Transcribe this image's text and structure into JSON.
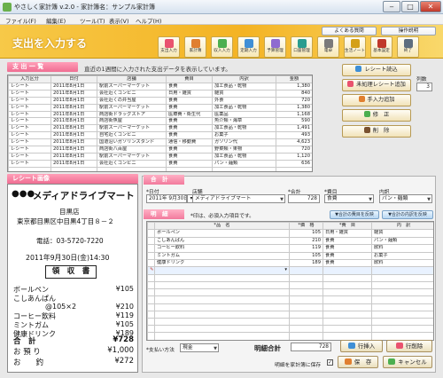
{
  "window": {
    "title": "やさしく家計簿 v.2.0 - 家計簿名：サンプル家計簿"
  },
  "menu": [
    "ファイル(F)",
    "編集(E)",
    "ツール(T)",
    "表示(V)",
    "ヘルプ(H)"
  ],
  "banner": {
    "title": "支出を入力する",
    "faq": "よくある質問",
    "manual": "操作説明",
    "toolbar": [
      {
        "label": "支出入力",
        "icon": "expense-input-icon",
        "color": "#e9536f"
      },
      {
        "label": "家計簿",
        "icon": "ledger-icon",
        "color": "#e07f30"
      },
      {
        "label": "収入入力",
        "icon": "income-input-icon",
        "color": "#4caf50"
      },
      {
        "label": "定期入力",
        "icon": "recurring-icon",
        "color": "#3f8fd6"
      },
      {
        "label": "予算管理",
        "icon": "budget-icon",
        "color": "#8e6bd0"
      },
      {
        "label": "口座管理",
        "icon": "account-icon",
        "color": "#2a9d8f"
      },
      {
        "label": "電卓",
        "icon": "calculator-icon",
        "color": "#7a7a7a"
      },
      {
        "label": "生活ノート",
        "icon": "note-icon",
        "color": "#d4a017"
      },
      {
        "label": "基本設定",
        "icon": "settings-icon",
        "color": "#c0392b"
      },
      {
        "label": "終了",
        "icon": "exit-icon",
        "color": "#5d6d7e"
      }
    ]
  },
  "list": {
    "heading": "支 出 一 覧",
    "notice": "直近の1週間に入力された支出データを表示しています。",
    "columns": [
      "入力区分",
      "日付",
      "店舗",
      "費目",
      "内訳",
      "金額"
    ],
    "rows": [
      [
        "レシート",
        "2011年8月1日",
        "駅前スーパーマーケット",
        "食費",
        "加工食品・乾物",
        "1,380"
      ],
      [
        "レシート",
        "2011年8月1日",
        "会社近くコンビニ",
        "日用・雑貨",
        "雑貨",
        "840"
      ],
      [
        "レシート",
        "2011年8月1日",
        "会社近くの弁当屋",
        "食費",
        "外食",
        "720"
      ],
      [
        "レシート",
        "2011年8月1日",
        "駅前スーパーマーケット",
        "食費",
        "加工食品・乾物",
        "1,380"
      ],
      [
        "レシート",
        "2011年8月1日",
        "商店街ドラッグストア",
        "医療費・衛生代",
        "医薬品",
        "1,168"
      ],
      [
        "レシート",
        "2011年8月1日",
        "商店街魚屋",
        "食費",
        "魚介類・海草",
        "590"
      ],
      [
        "レシート",
        "2011年8月1日",
        "駅前スーパーマーケット",
        "食費",
        "加工食品・乾物",
        "1,491"
      ],
      [
        "レシート",
        "2011年8月1日",
        "自宅近くコンビニ",
        "食費",
        "お菓子",
        "493"
      ],
      [
        "レシート",
        "2011年8月1日",
        "国道沿いガソリンスタンド",
        "通信・移動費",
        "ガソリン代",
        "4,623"
      ],
      [
        "レシート",
        "2011年8月1日",
        "商店街八百屋",
        "食費",
        "野菜類・果物",
        "720"
      ],
      [
        "レシート",
        "2011年8月1日",
        "駅前スーパーマーケット",
        "食費",
        "加工食品・乾物",
        "1,120"
      ],
      [
        "レシート",
        "2011年8月1日",
        "会社近くコンビニ",
        "食費",
        "パン・麺類",
        "636"
      ]
    ]
  },
  "side": {
    "read_receipt": "レシート読込",
    "unprocessed": "未処理レシート追加",
    "manual_add": "手入力追加",
    "edit": "修　正",
    "delete": "削　除",
    "count_label": "列数",
    "count_value": "3"
  },
  "receipt": {
    "heading": "レシート画像",
    "store": "メディアドライブマート",
    "branch": "目黒店",
    "address": "東京都目黒区中目黒4丁目８－２",
    "phone": "電話：03-5720-7220",
    "datetime": "2011年9月30日(金)14:30",
    "doc_title": "領　収　書",
    "lines": [
      {
        "name": "ボールペン",
        "price": "¥105"
      },
      {
        "name": "こしあんぱん",
        "price": ""
      },
      {
        "name": "@105×2",
        "price": "¥210"
      },
      {
        "name": "コーヒー飲料",
        "price": "¥119"
      },
      {
        "name": "ミントガム",
        "price": "¥105"
      },
      {
        "name": "健康ドリンク",
        "price": "¥189"
      }
    ],
    "total_label": "合　計",
    "total": "¥728",
    "paid_label": "お 預 り",
    "paid": "¥1,000",
    "change_label": "お　　釣",
    "change": "¥272"
  },
  "entry": {
    "heading": "合　計",
    "date_label": "*日付",
    "date_value": "2011年  9月30日",
    "store_label": "店舗",
    "store_value": "メディアドライブマート",
    "amount_label": "*合計",
    "amount_value": "728",
    "category_label": "*費目",
    "category_value": "食費",
    "subcategory_label": "内訳",
    "subcategory_value": "パン・麺類",
    "detail_heading": "明　細",
    "detail_note": "*印は、必須入力項目です。",
    "apply_all": "▼合計の費目を反映",
    "apply_sub": "▼合計の内訳を反映",
    "grid_columns": [
      "*品　名",
      "*価　格",
      "*費　目",
      "内　訳"
    ],
    "grid_rows": [
      [
        "ボールペン",
        "105",
        "日用・雑貨",
        "雑貨"
      ],
      [
        "こしあんぱん",
        "210",
        "食費",
        "パン・麺類"
      ],
      [
        "コーヒー飲料",
        "119",
        "食費",
        "飲料"
      ],
      [
        "ミントガム",
        "105",
        "食費",
        "お菓子"
      ],
      [
        "健康ドリンク",
        "189",
        "食費",
        "飲料"
      ]
    ],
    "payment_label": "*支払い方法",
    "payment_value": "現金",
    "detail_total_label": "明細合計",
    "detail_total_value": "728",
    "insert_row": "行挿入",
    "delete_row": "行削除",
    "save_to_book": "明細を家計簿に保存",
    "save": "保　存",
    "cancel": "キャンセル"
  }
}
